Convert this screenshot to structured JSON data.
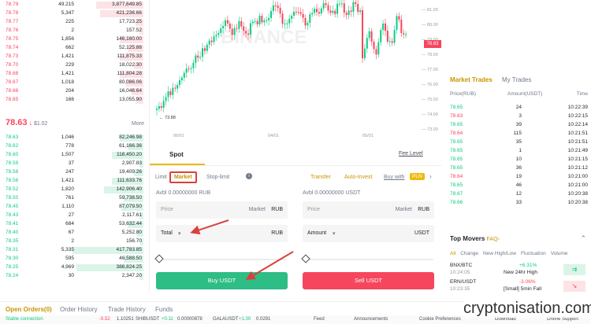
{
  "orderbook": {
    "asks": [
      [
        "78.79",
        "49.215",
        "3,877,649.85"
      ],
      [
        "78.78",
        "5,347",
        "421,236.66"
      ],
      [
        "78.77",
        "225",
        "17,723.25"
      ],
      [
        "78.76",
        "2",
        "157.52"
      ],
      [
        "78.75",
        "1,856",
        "146,160.00"
      ],
      [
        "78.74",
        "662",
        "52,125.88"
      ],
      [
        "78.73",
        "1,421",
        "111,875.33"
      ],
      [
        "78.70",
        "229",
        "18,022.30"
      ],
      [
        "78.68",
        "1,421",
        "111,804.28"
      ],
      [
        "78.67",
        "1,018",
        "80,086.06"
      ],
      [
        "78.66",
        "204",
        "16,046.64"
      ],
      [
        "78.65",
        "166",
        "13,055.90"
      ]
    ],
    "mid_price": "78.63",
    "mid_arrow": "↓",
    "mid_usd": "$1.02",
    "more": "More",
    "bids": [
      [
        "78.63",
        "1,046",
        "82,246.98"
      ],
      [
        "78.62",
        "778",
        "61,166.36"
      ],
      [
        "78.60",
        "1,507",
        "118,450.20"
      ],
      [
        "78.59",
        "37",
        "2,907.83"
      ],
      [
        "78.58",
        "247",
        "19,409.26"
      ],
      [
        "78.56",
        "1,421",
        "111,633.76"
      ],
      [
        "78.52",
        "1,820",
        "142,906.40"
      ],
      [
        "78.50",
        "761",
        "59,738.50"
      ],
      [
        "78.45",
        "1,110",
        "87,079.50"
      ],
      [
        "78.43",
        "27",
        "2,117.61"
      ],
      [
        "78.41",
        "684",
        "53,632.44"
      ],
      [
        "78.40",
        "67",
        "5,252.80"
      ],
      [
        "78.35",
        "2",
        "156.70"
      ],
      [
        "78.31",
        "5,335",
        "417,783.85"
      ],
      [
        "78.30",
        "595",
        "46,588.50"
      ],
      [
        "78.25",
        "4,969",
        "388,824.25"
      ],
      [
        "78.24",
        "30",
        "2,347.20"
      ]
    ]
  },
  "chart": {
    "watermark": "BINANCE",
    "low_label": "73.88",
    "price_tag": "78.63",
    "y_ticks": [
      "81.00",
      "80.00",
      "79.00",
      "78.00",
      "77.00",
      "76.00",
      "75.00",
      "74.00",
      "73.00"
    ],
    "x_ticks": [
      "06/01",
      "04/01",
      "05/01"
    ]
  },
  "trade": {
    "tab": "Spot",
    "fee": "Fee Level",
    "tabs": [
      "Limit",
      "Market",
      "Stop-limit"
    ],
    "transfer": "Transfer",
    "auto_invest": "Auto-Invest",
    "buy_with": "Buy with",
    "pln": "PLN",
    "buy_avbl": "Avbl  0.00000000 RUB",
    "sell_avbl": "Avbl  0.00000000 USDT",
    "price_label": "Price",
    "market_label": "Market",
    "rub": "RUB",
    "total_label": "Total",
    "amount_label": "Amount",
    "usdt": "USDT",
    "buy_btn": "Buy USDT",
    "sell_btn": "Sell USDT"
  },
  "market_trades": {
    "tabs": [
      "Market Trades",
      "My Trades"
    ],
    "headers": [
      "Price(RUB)",
      "Amount(USDT)",
      "Time"
    ],
    "rows": [
      [
        "78.65",
        "24",
        "10:22:39",
        "g"
      ],
      [
        "78.63",
        "3",
        "10:22:15",
        "r"
      ],
      [
        "78.65",
        "39",
        "10:22:14",
        "g"
      ],
      [
        "78.64",
        "115",
        "10:21:51",
        "r"
      ],
      [
        "78.65",
        "35",
        "10:21:51",
        "g"
      ],
      [
        "78.65",
        "1",
        "10:21:49",
        "g"
      ],
      [
        "78.65",
        "10",
        "10:21:15",
        "g"
      ],
      [
        "78.65",
        "36",
        "10:21:12",
        "g"
      ],
      [
        "78.64",
        "19",
        "10:21:00",
        "r"
      ],
      [
        "78.65",
        "46",
        "10:21:00",
        "g"
      ],
      [
        "78.67",
        "12",
        "10:20:38",
        "g"
      ],
      [
        "78.66",
        "33",
        "10:20:38",
        "g"
      ]
    ]
  },
  "top_movers": {
    "title": "Top Movers",
    "faq": "FAQ›",
    "filters": [
      "All",
      "Change",
      "New High/Low",
      "Fluctuation",
      "Volume"
    ],
    "items": [
      {
        "pair": "BNX/BTC",
        "time": "10:24:05",
        "change": "+6.31%",
        "desc": "New 24hr High",
        "color": "#0ecb81"
      },
      {
        "pair": "ERN/USDT",
        "time": "10:23:35",
        "change": "-3.06%",
        "desc": "[Small] 5min Fall",
        "color": "#f6465d"
      }
    ]
  },
  "bottom": {
    "tabs": [
      "Open Orders(0)",
      "Order History",
      "Trade History",
      "Funds"
    ],
    "status": "Stable connection",
    "ticker1": "-5.52",
    "ticker1b": "1.10251",
    "ticker2": "SHIBUSDT",
    "ticker2b": "+0.11",
    "ticker2c": "0.00000878",
    "ticker3": "GALAUSDT",
    "ticker3b": "+1.30",
    "ticker3c": "0.0291",
    "feed": "Feed",
    "announcements": "Announcements",
    "cookie": "Cookie Preferences",
    "download": "Download",
    "support": "Online Support"
  },
  "watermark_site": "cryptonisation.com"
}
